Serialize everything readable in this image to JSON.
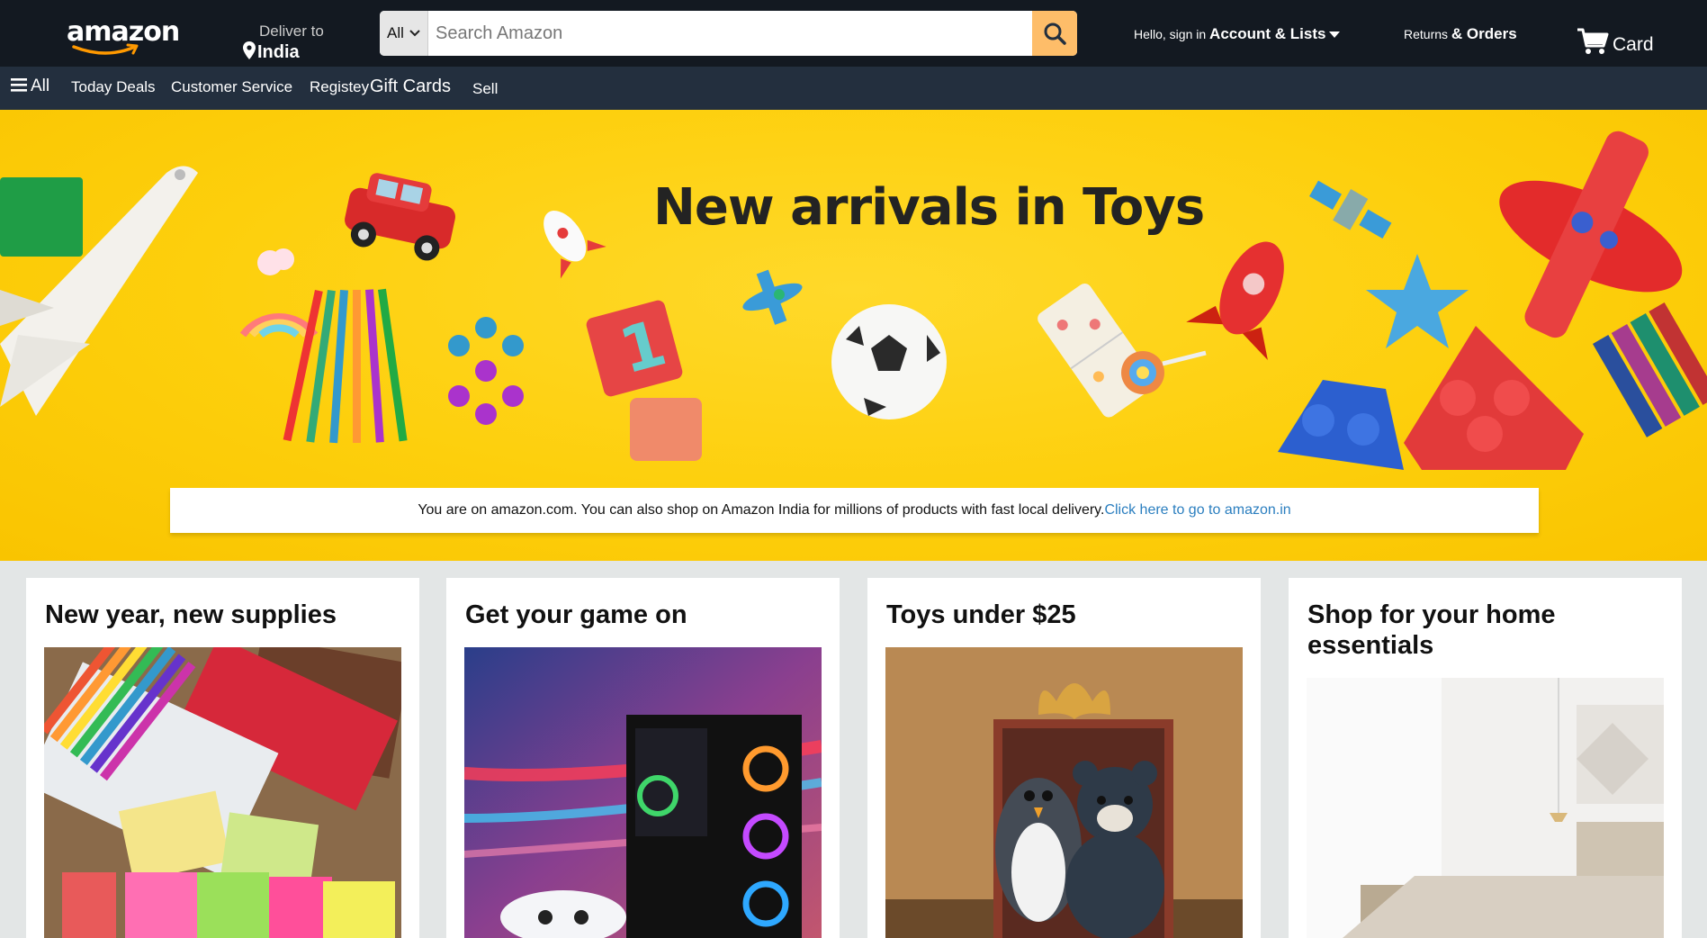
{
  "header": {
    "logo_text": "amazon",
    "deliver_label": "Deliver to",
    "deliver_location": "India",
    "search_category": "All",
    "search_placeholder": "Search Amazon",
    "account_greeting": "Hello, sign in",
    "account_label": "Account & Lists",
    "returns_label": "Returns",
    "orders_label": "& Orders",
    "cart_label": "Card"
  },
  "subnav": {
    "all_label": "All",
    "items": [
      "Today Deals",
      "Customer Service",
      "Registey",
      "Gift Cards",
      "Sell"
    ]
  },
  "hero": {
    "title": "New arrivals in Toys",
    "notice_text": "You are on amazon.com. You can also shop on Amazon India for millions of products with fast local delivery.",
    "notice_link": "Click here to go to amazon.in"
  },
  "cards": [
    {
      "title": "New year, new supplies"
    },
    {
      "title": "Get your game on"
    },
    {
      "title": "Toys under $25"
    },
    {
      "title": "Shop for your home essentials"
    }
  ],
  "colors": {
    "nav_top": "#131921",
    "nav_bottom": "#232f3e",
    "search_button": "#febd69",
    "hero_yellow": "#fdcf0c",
    "link": "#2a7ebf"
  }
}
